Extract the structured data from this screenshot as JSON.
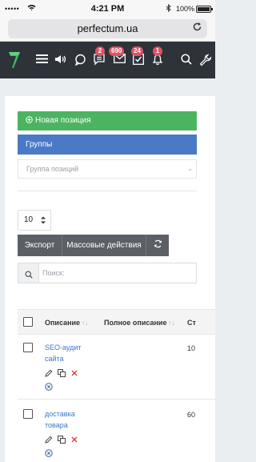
{
  "status_bar": {
    "signal": "•••••",
    "wifi": "wifi-icon",
    "time": "4:21 PM",
    "battery": "100%"
  },
  "browser": {
    "url": "perfectum.ua"
  },
  "header": {
    "icons": [
      "menu-icon",
      "volume-icon",
      "chat-icon",
      "messages-icon",
      "mail-icon",
      "tasks-icon",
      "bell-icon",
      "search-icon",
      "wrench-icon"
    ],
    "badges": {
      "messages": "2",
      "mail": "690",
      "tasks": "24",
      "notifications": "1"
    },
    "colors": {
      "bar": "#2d3339",
      "badge": "#e05266",
      "logo": "#3fb867"
    }
  },
  "main": {
    "new_position_label": "Новая позиция",
    "groups_label": "Группы",
    "group_select_placeholder": "Группа позиций",
    "per_page": "10",
    "toolbar": {
      "export_label": "Экспорт",
      "bulk_label": "Массовые действия"
    },
    "search_placeholder": "Поиск:"
  },
  "table": {
    "headers": {
      "description": "Описание",
      "full_description": "Полное описание",
      "next": "Ст"
    },
    "rows": [
      {
        "line1": "SEO-аудит",
        "line2": "сайта",
        "value": "10"
      },
      {
        "line1": "доставка",
        "line2": "товара",
        "value": "60"
      }
    ]
  }
}
